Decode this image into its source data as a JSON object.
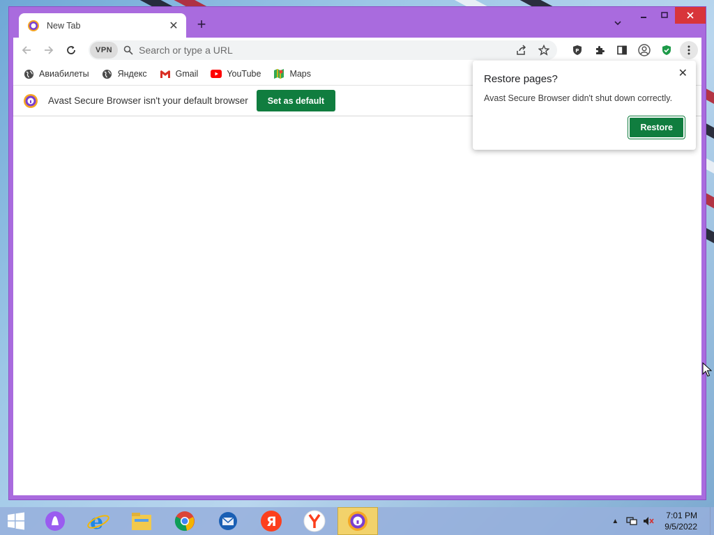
{
  "colors": {
    "frame": "#a96bde",
    "accent_green": "#107d3f",
    "close_red": "#d8353a",
    "taskbar": "#96afdc"
  },
  "tabs": [
    {
      "title": "New Tab",
      "icon": "avast-browser-logo",
      "active": true
    }
  ],
  "window_controls": {
    "minimize": "minimize-icon",
    "maximize": "maximize-icon",
    "close": "close-icon"
  },
  "toolbar": {
    "vpn_label": "VPN",
    "omnibox_placeholder": "Search or type a URL",
    "icons": [
      "back-icon",
      "forward-icon",
      "reload-icon",
      "share-icon",
      "bookmark-star-icon",
      "privacy-guard-icon",
      "extensions-icon",
      "side-panel-icon",
      "profile-icon",
      "security-shield-icon",
      "menu-icon"
    ]
  },
  "bookmarks": [
    {
      "label": "Авиабилеты",
      "icon": "globe-icon"
    },
    {
      "label": "Яндекс",
      "icon": "globe-icon"
    },
    {
      "label": "Gmail",
      "icon": "gmail-icon"
    },
    {
      "label": "YouTube",
      "icon": "youtube-icon"
    },
    {
      "label": "Maps",
      "icon": "maps-icon"
    }
  ],
  "infobar": {
    "message": "Avast Secure Browser isn't your default browser",
    "button": "Set as default"
  },
  "restore_popup": {
    "title": "Restore pages?",
    "message": "Avast Secure Browser didn't shut down correctly.",
    "button": "Restore"
  },
  "taskbar": {
    "apps": [
      "alice-assistant",
      "internet-explorer",
      "file-explorer",
      "chrome",
      "thunderbird",
      "yandex",
      "yandex-browser",
      "avast-secure-browser"
    ],
    "clock_time": "7:01 PM",
    "clock_date": "9/5/2022"
  }
}
